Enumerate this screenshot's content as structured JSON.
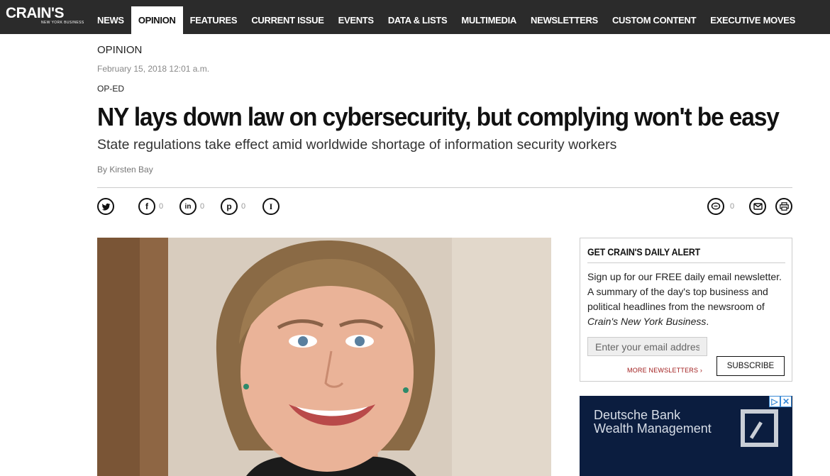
{
  "logo": {
    "text": "CRAIN'S",
    "subtitle": "NEW YORK BUSINESS"
  },
  "nav": {
    "items": [
      {
        "label": "NEWS"
      },
      {
        "label": "OPINION",
        "active": true
      },
      {
        "label": "FEATURES"
      },
      {
        "label": "CURRENT ISSUE"
      },
      {
        "label": "EVENTS"
      },
      {
        "label": "DATA & LISTS"
      },
      {
        "label": "MULTIMEDIA"
      },
      {
        "label": "NEWSLETTERS"
      },
      {
        "label": "CUSTOM CONTENT"
      },
      {
        "label": "EXECUTIVE MOVES"
      }
    ]
  },
  "article": {
    "section": "OPINION",
    "date": "February 15, 2018 12:01 a.m.",
    "kicker": "OP-ED",
    "headline": "NY lays down law on cybersecurity, but complying won't be easy",
    "subhead": "State regulations take effect amid worldwide shortage of information security workers",
    "byline": "By Kirsten Bay"
  },
  "share": {
    "twitter_icon": "twitter-icon",
    "facebook_count": "0",
    "linkedin_count": "0",
    "pinterest_count": "0",
    "comments_count": "0"
  },
  "newsletter": {
    "title": "GET CRAIN'S DAILY ALERT",
    "text_before": "Sign up for our FREE daily email newsletter. A summary of the day's top business and political headlines from the newsroom of ",
    "text_italic": "Crain's New York Business",
    "text_after": ".",
    "placeholder": "Enter your email address",
    "more_link": "MORE NEWSLETTERS ›",
    "subscribe_label": "SUBSCRIBE"
  },
  "ad": {
    "line1": "Deutsche Bank",
    "line2": "Wealth Management",
    "adchoices_play": "▷",
    "adchoices_close": "✕",
    "bg_color": "#0b1d3f"
  },
  "colors": {
    "nav_bg": "#2b2b2b",
    "link_red": "#a01c1c"
  }
}
